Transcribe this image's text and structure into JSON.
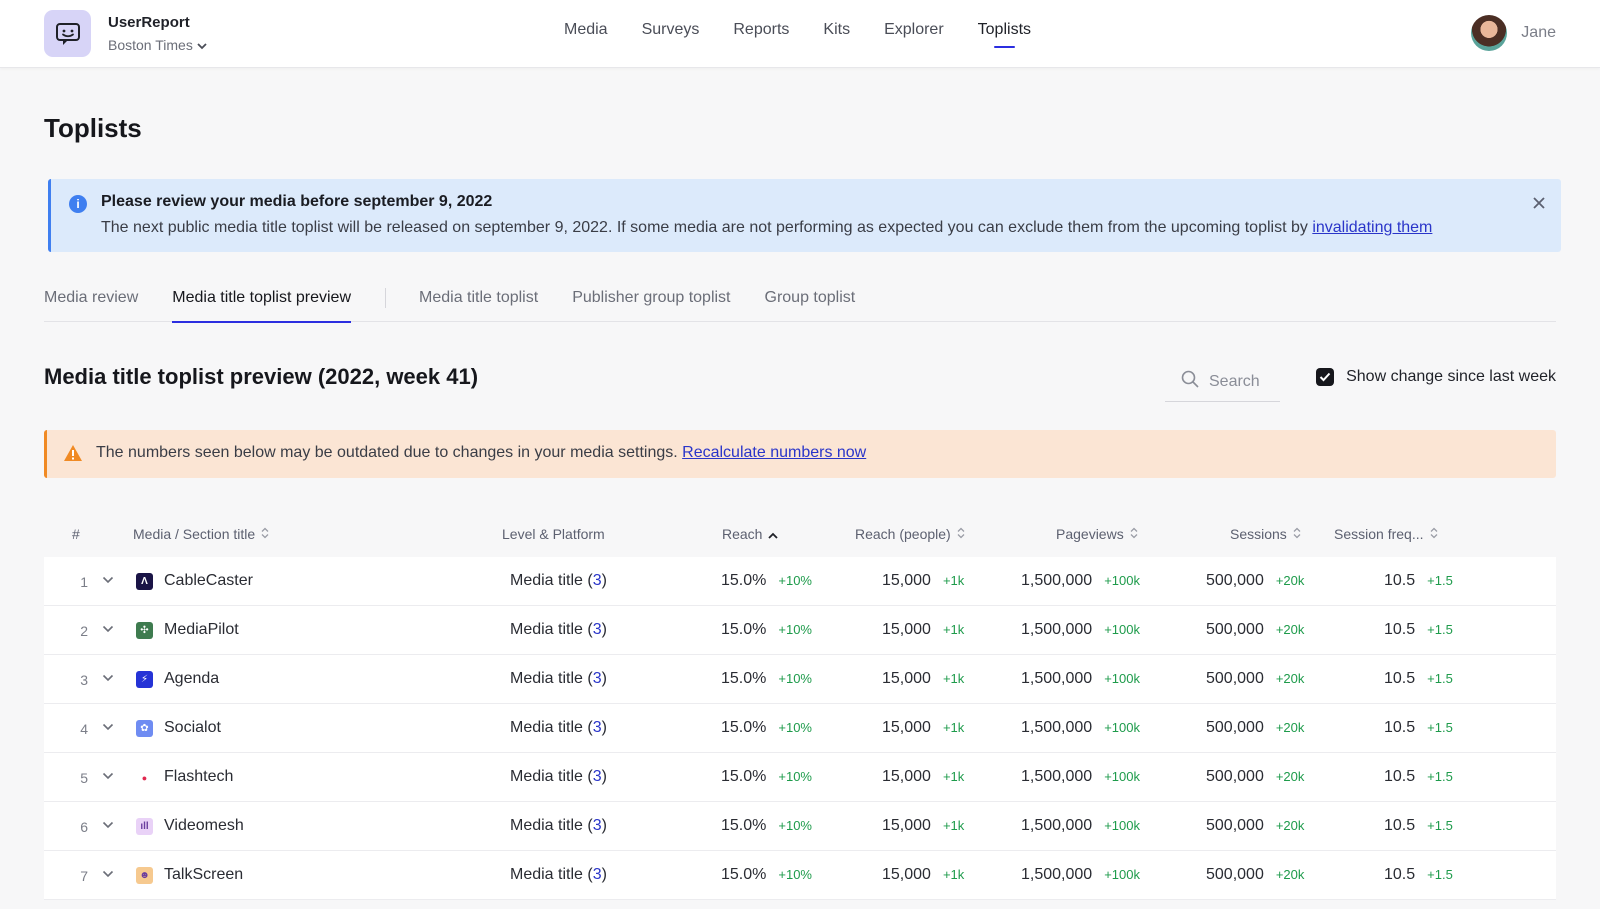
{
  "app": {
    "name": "UserReport",
    "org": "Boston Times"
  },
  "nav": {
    "items": [
      {
        "label": "Media"
      },
      {
        "label": "Surveys"
      },
      {
        "label": "Reports"
      },
      {
        "label": "Kits"
      },
      {
        "label": "Explorer"
      },
      {
        "label": "Toplists"
      }
    ],
    "active": "Toplists"
  },
  "user": {
    "name": "Jane"
  },
  "page": {
    "title": "Toplists"
  },
  "info_banner": {
    "title": "Please review your media before september 9, 2022",
    "text": "The next public media title toplist will be released on september 9, 2022. If some media are not performing as expected you can exclude them from the upcoming toplist by ",
    "link": "invalidating them"
  },
  "tabs": [
    {
      "label": "Media review"
    },
    {
      "label": "Media title toplist preview"
    },
    {
      "label": "Media title toplist"
    },
    {
      "label": "Publisher group toplist"
    },
    {
      "label": "Group toplist"
    }
  ],
  "section": {
    "title": "Media title toplist preview (2022, week 41)",
    "search_placeholder": "Search",
    "show_change_label": "Show change since last week",
    "show_change_checked": true
  },
  "warning_banner": {
    "text": "The numbers seen below may be outdated due to changes in your media settings. ",
    "link": "Recalculate numbers now"
  },
  "table": {
    "columns": {
      "rank": "#",
      "title": "Media / Section title",
      "level": "Level & Platform",
      "reach": "Reach",
      "reach_people": "Reach (people)",
      "pageviews": "Pageviews",
      "sessions": "Sessions",
      "session_freq": "Session freq..."
    },
    "rows": [
      {
        "rank": "1",
        "name": "CableCaster",
        "icon": "cablecaster-logo-icon",
        "color": "#1a1446",
        "glyph": "Λ",
        "level": "Media title (",
        "level_count": "3",
        "level_end": ")",
        "reach": "15.0%",
        "reach_delta": "+10%",
        "people": "15,000",
        "people_delta": "+1k",
        "pageviews": "1,500,000",
        "pageviews_delta": "+100k",
        "sessions": "500,000",
        "sessions_delta": "+20k",
        "freq": "10.5",
        "freq_delta": "+1.5"
      },
      {
        "rank": "2",
        "name": "MediaPilot",
        "icon": "mediapilot-logo-icon",
        "color": "#3e7b4f",
        "glyph": "✣",
        "level": "Media title (",
        "level_count": "3",
        "level_end": ")",
        "reach": "15.0%",
        "reach_delta": "+10%",
        "people": "15,000",
        "people_delta": "+1k",
        "pageviews": "1,500,000",
        "pageviews_delta": "+100k",
        "sessions": "500,000",
        "sessions_delta": "+20k",
        "freq": "10.5",
        "freq_delta": "+1.5"
      },
      {
        "rank": "3",
        "name": "Agenda",
        "icon": "agenda-logo-icon",
        "color": "#2533d6",
        "glyph": "⚡",
        "level": "Media title (",
        "level_count": "3",
        "level_end": ")",
        "reach": "15.0%",
        "reach_delta": "+10%",
        "people": "15,000",
        "people_delta": "+1k",
        "pageviews": "1,500,000",
        "pageviews_delta": "+100k",
        "sessions": "500,000",
        "sessions_delta": "+20k",
        "freq": "10.5",
        "freq_delta": "+1.5"
      },
      {
        "rank": "4",
        "name": "Socialot",
        "icon": "socialot-logo-icon",
        "color": "#6f8cf2",
        "glyph": "✿",
        "level": "Media title (",
        "level_count": "3",
        "level_end": ")",
        "reach": "15.0%",
        "reach_delta": "+10%",
        "people": "15,000",
        "people_delta": "+1k",
        "pageviews": "1,500,000",
        "pageviews_delta": "+100k",
        "sessions": "500,000",
        "sessions_delta": "+20k",
        "freq": "10.5",
        "freq_delta": "+1.5"
      },
      {
        "rank": "5",
        "name": "Flashtech",
        "icon": "flashtech-logo-icon",
        "color": "#ffffff",
        "glyph": "●",
        "level": "Media title (",
        "level_count": "3",
        "level_end": ")",
        "reach": "15.0%",
        "reach_delta": "+10%",
        "people": "15,000",
        "people_delta": "+1k",
        "pageviews": "1,500,000",
        "pageviews_delta": "+100k",
        "sessions": "500,000",
        "sessions_delta": "+20k",
        "freq": "10.5",
        "freq_delta": "+1.5"
      },
      {
        "rank": "6",
        "name": "Videomesh",
        "icon": "videomesh-logo-icon",
        "color": "#e9d2f7",
        "glyph": "ıll",
        "level": "Media title (",
        "level_count": "3",
        "level_end": ")",
        "reach": "15.0%",
        "reach_delta": "+10%",
        "people": "15,000",
        "people_delta": "+1k",
        "pageviews": "1,500,000",
        "pageviews_delta": "+100k",
        "sessions": "500,000",
        "sessions_delta": "+20k",
        "freq": "10.5",
        "freq_delta": "+1.5"
      },
      {
        "rank": "7",
        "name": "TalkScreen",
        "icon": "talkscreen-logo-icon",
        "color": "#f6c98f",
        "glyph": "☻",
        "level": "Media title (",
        "level_count": "3",
        "level_end": ")",
        "reach": "15.0%",
        "reach_delta": "+10%",
        "people": "15,000",
        "people_delta": "+1k",
        "pageviews": "1,500,000",
        "pageviews_delta": "+100k",
        "sessions": "500,000",
        "sessions_delta": "+20k",
        "freq": "10.5",
        "freq_delta": "+1.5"
      }
    ]
  },
  "colors": {
    "accent": "#2b2ee0",
    "link": "#2a35c9",
    "positive": "#1e9b4b",
    "info_bg": "#dceafb",
    "warning_bg": "#fbe5d4",
    "warning_accent": "#f08a24"
  }
}
